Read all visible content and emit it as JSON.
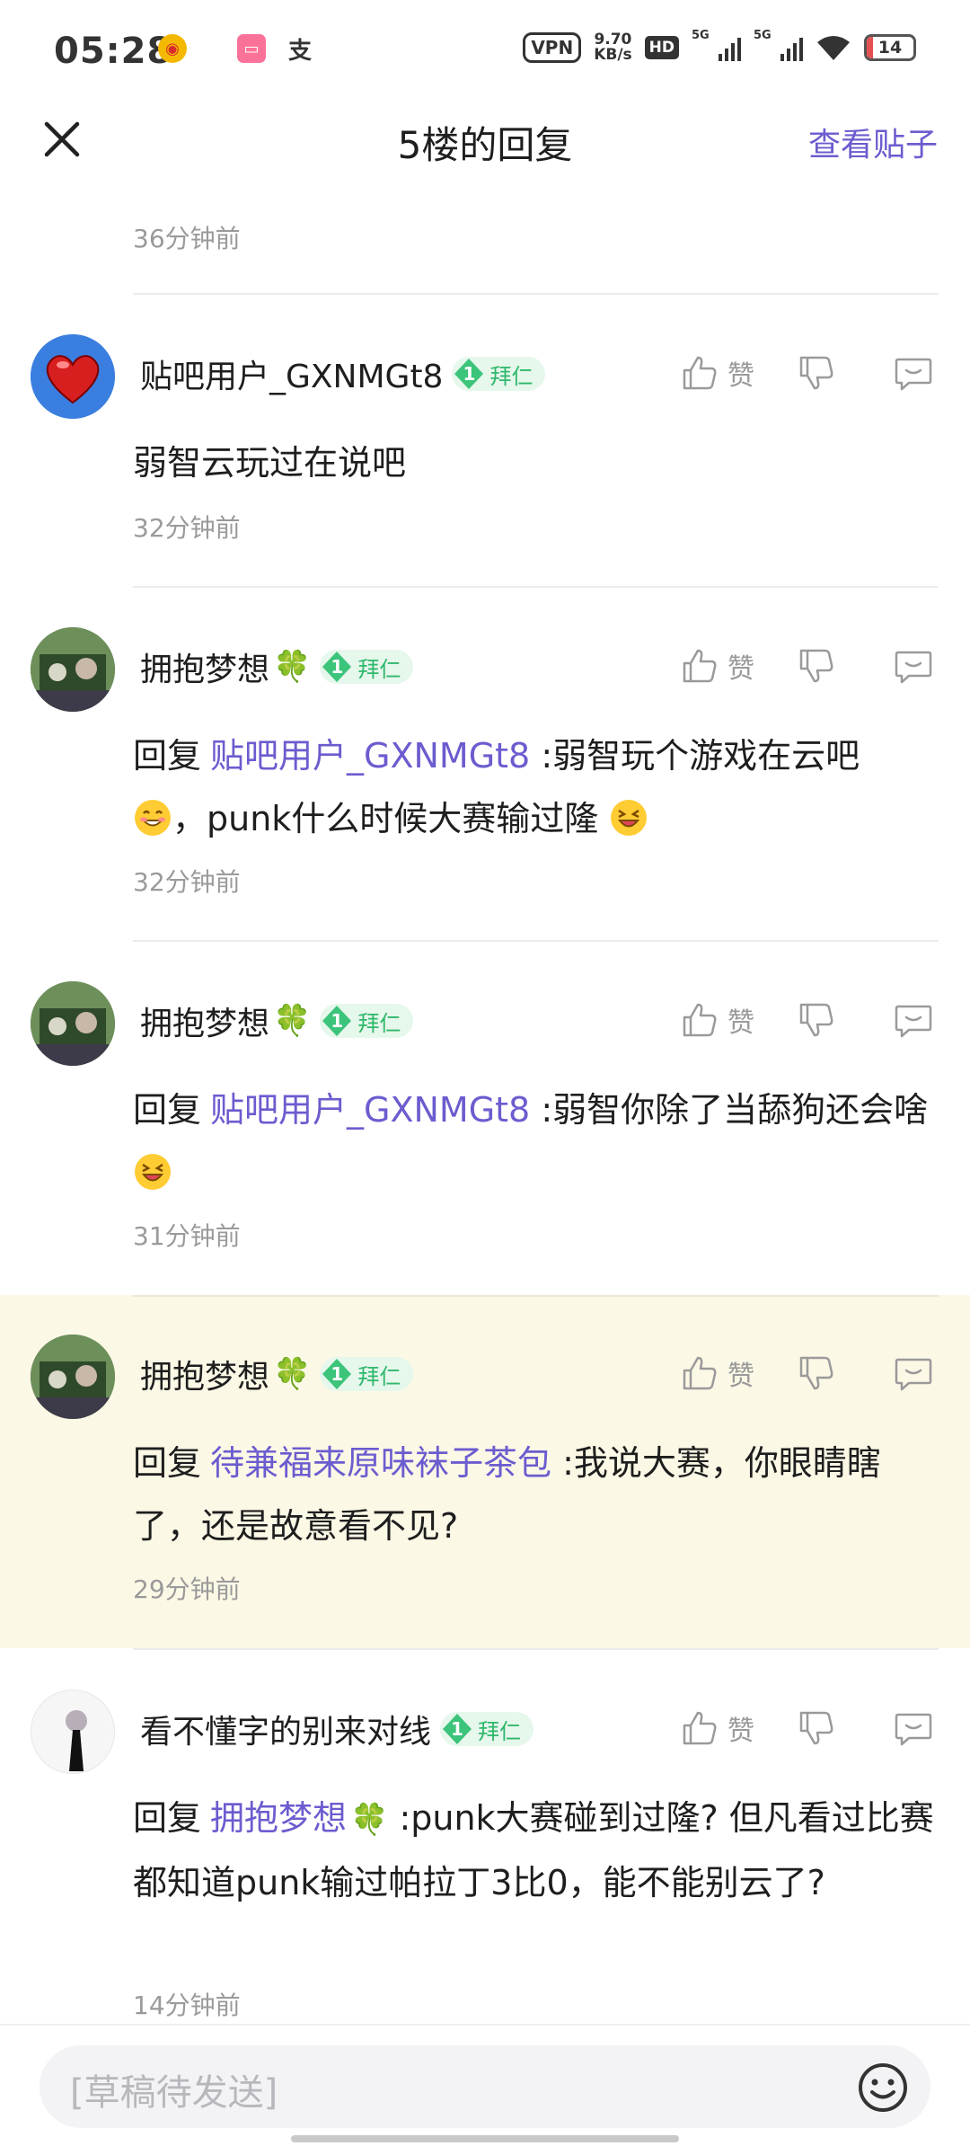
{
  "status_bar": {
    "time": "05:28",
    "vpn": "VPN",
    "speed_value": "9.70",
    "speed_unit": "KB/s",
    "hd": "HD",
    "net1": "5G",
    "net2": "5G",
    "battery": "14"
  },
  "header": {
    "title": "5楼的回复",
    "view_post": "查看贴子"
  },
  "first_time": "36分钟前",
  "badge_level": "1",
  "badge_text": "拜仁",
  "like_label": "赞",
  "comments": [
    {
      "username": "贴吧用户_GXNMGt8",
      "has_clover": false,
      "content_text": "弱智云玩过在说吧",
      "time": "32分钟前"
    },
    {
      "username": "拥抱梦想",
      "has_clover": true,
      "reply_prefix": "回复",
      "mention": "贴吧用户_GXNMGt8",
      "content_text": " :弱智玩个游戏在云吧",
      "content_text2": "，punk什么时候大赛输过隆",
      "time": "32分钟前"
    },
    {
      "username": "拥抱梦想",
      "has_clover": true,
      "reply_prefix": "回复",
      "mention": "贴吧用户_GXNMGt8",
      "content_text": " :弱智你除了当舔狗还会啥",
      "time": "31分钟前"
    },
    {
      "username": "拥抱梦想",
      "has_clover": true,
      "reply_prefix": "回复",
      "mention": "待兼福来原味袜子茶包",
      "content_text": " :我说大赛，你眼睛瞎了，还是故意看不见?",
      "time": "29分钟前"
    },
    {
      "username": "看不懂字的别来对线",
      "has_clover": false,
      "reply_prefix": "回复",
      "mention": "拥抱梦想",
      "content_text": " :punk大赛碰到过隆? 但凡看过比赛都知道punk输过帕拉丁3比0，能不能别云了?",
      "time": "14分钟前"
    }
  ],
  "input": {
    "placeholder": "[草稿待发送]"
  },
  "colors": {
    "accent": "#6b5ccf",
    "highlight": "#fcf8e6",
    "badge": "#2fb86b"
  }
}
